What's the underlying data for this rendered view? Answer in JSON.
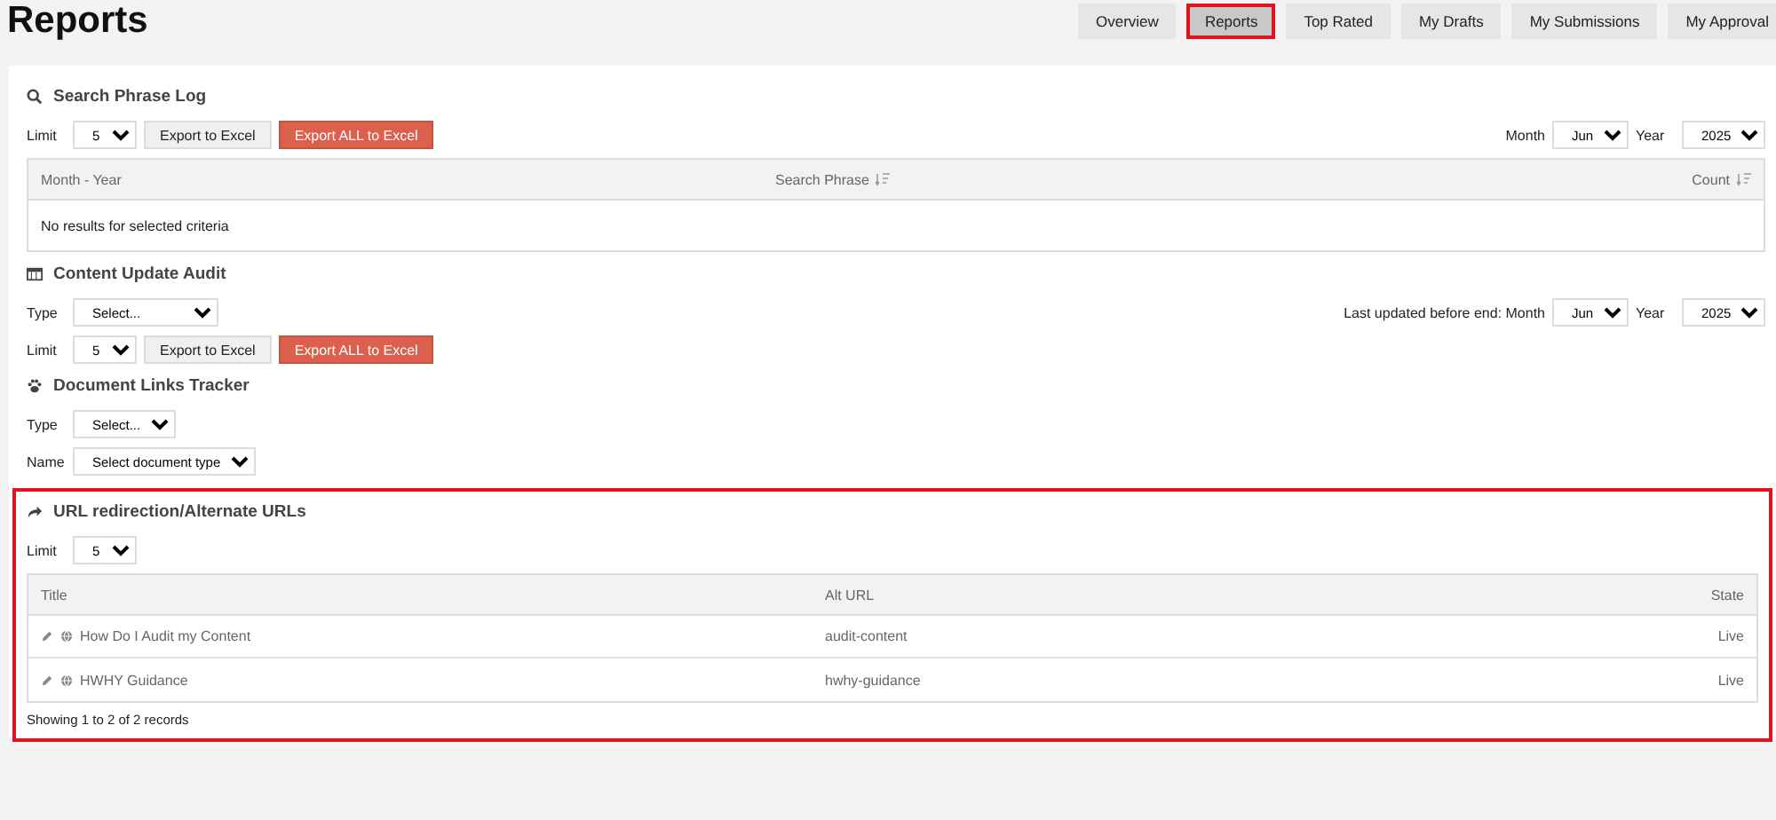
{
  "page_title": "Reports",
  "tabs": [
    {
      "label": "Overview",
      "selected": false,
      "highlighted": false
    },
    {
      "label": "Reports",
      "selected": true,
      "highlighted": true
    },
    {
      "label": "Top Rated",
      "selected": false,
      "highlighted": false
    },
    {
      "label": "My Drafts",
      "selected": false,
      "highlighted": false
    },
    {
      "label": "My Submissions",
      "selected": false,
      "highlighted": false
    },
    {
      "label": "My Approval",
      "selected": false,
      "highlighted": false
    }
  ],
  "search_phrase_log": {
    "title": "Search Phrase Log",
    "limit_label": "Limit",
    "limit": "5",
    "export_button": "Export to Excel",
    "export_all_button": "Export ALL to Excel",
    "month_label": "Month",
    "month": "Jun",
    "year_label": "Year",
    "year": "2025",
    "columns": [
      {
        "label": "Month - Year",
        "sortable": false
      },
      {
        "label": "Search Phrase",
        "sortable": true
      },
      {
        "label": "Count",
        "sortable": true
      }
    ],
    "empty_message": "No results for selected criteria"
  },
  "content_update_audit": {
    "title": "Content Update Audit",
    "type_label": "Type",
    "type": "Select...",
    "date_label": "Last updated before end: Month",
    "month": "Jun",
    "year_label": "Year",
    "year": "2025",
    "limit_label": "Limit",
    "limit": "5",
    "export_button": "Export to Excel",
    "export_all_button": "Export ALL to Excel"
  },
  "document_links_tracker": {
    "title": "Document Links Tracker",
    "type_label": "Type",
    "type": "Select...",
    "name_label": "Name",
    "name": "Select document type"
  },
  "url_redirection": {
    "title": "URL redirection/Alternate URLs",
    "highlighted": true,
    "limit_label": "Limit",
    "limit": "5",
    "columns": [
      "Title",
      "Alt URL",
      "State"
    ],
    "rows": [
      {
        "title": "How Do I Audit my Content",
        "alt_url": "audit-content",
        "state": "Live"
      },
      {
        "title": "HWHY Guidance",
        "alt_url": "hwhy-guidance",
        "state": "Live"
      }
    ],
    "footer": "Showing 1 to 2 of 2 records"
  }
}
